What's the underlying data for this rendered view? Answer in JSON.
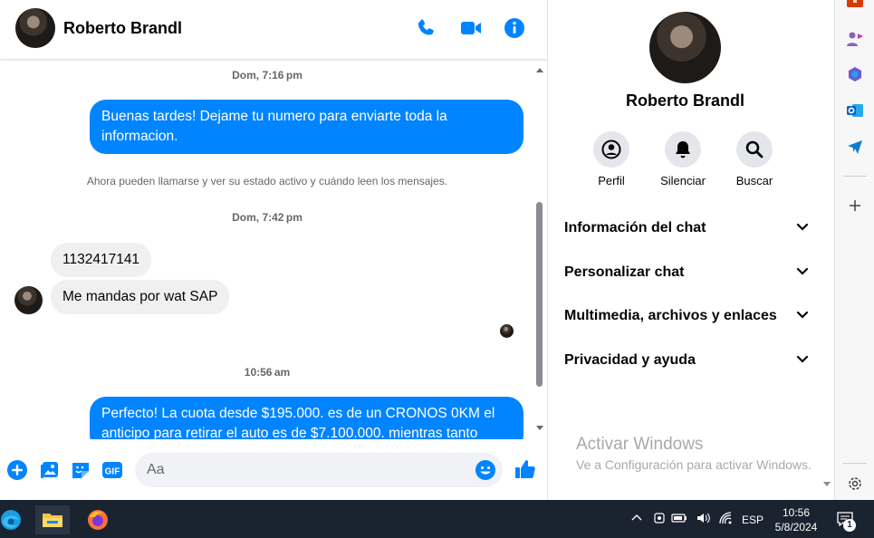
{
  "contact": {
    "name": "Roberto Brandl"
  },
  "header": {
    "call_label": "",
    "video_label": "",
    "info_label": ""
  },
  "messages": {
    "ts1": "Dom, 7:16 pm",
    "out1": "Buenas tardes! Dejame tu numero para enviarte toda la informacion.",
    "system": "Ahora pueden llamarse y ver su estado activo y cuándo leen los mensajes.",
    "ts2": "Dom, 7:42 pm",
    "in1": "1132417141",
    "in2": "Me mandas por wat SAP",
    "ts3": "10:56 am",
    "out2": "Perfecto! La cuota desde $195.000. es de un CRONOS 0KM el anticipo para retirar el auto es de $7.100.000. mientras tanto"
  },
  "composer": {
    "placeholder": "Aa"
  },
  "info_panel": {
    "name": "Roberto Brandl",
    "actions": [
      {
        "label": "Perfil",
        "icon": "profile-icon"
      },
      {
        "label": "Silenciar",
        "icon": "bell-icon"
      },
      {
        "label": "Buscar",
        "icon": "search-icon"
      }
    ],
    "sections": [
      {
        "label": "Información del chat"
      },
      {
        "label": "Personalizar chat"
      },
      {
        "label": "Multimedia, archivos y enlaces"
      },
      {
        "label": "Privacidad y ayuda"
      }
    ]
  },
  "watermark": {
    "title": "Activar Windows",
    "subtitle": "Ve a Configuración para activar Windows."
  },
  "taskbar": {
    "language": "ESP",
    "time": "10:56",
    "date": "5/8/2024",
    "notification_count": "1"
  },
  "colors": {
    "messenger_blue": "#0084ff",
    "incoming_bubble": "#f0f0f0",
    "taskbar": "#1a2330"
  }
}
